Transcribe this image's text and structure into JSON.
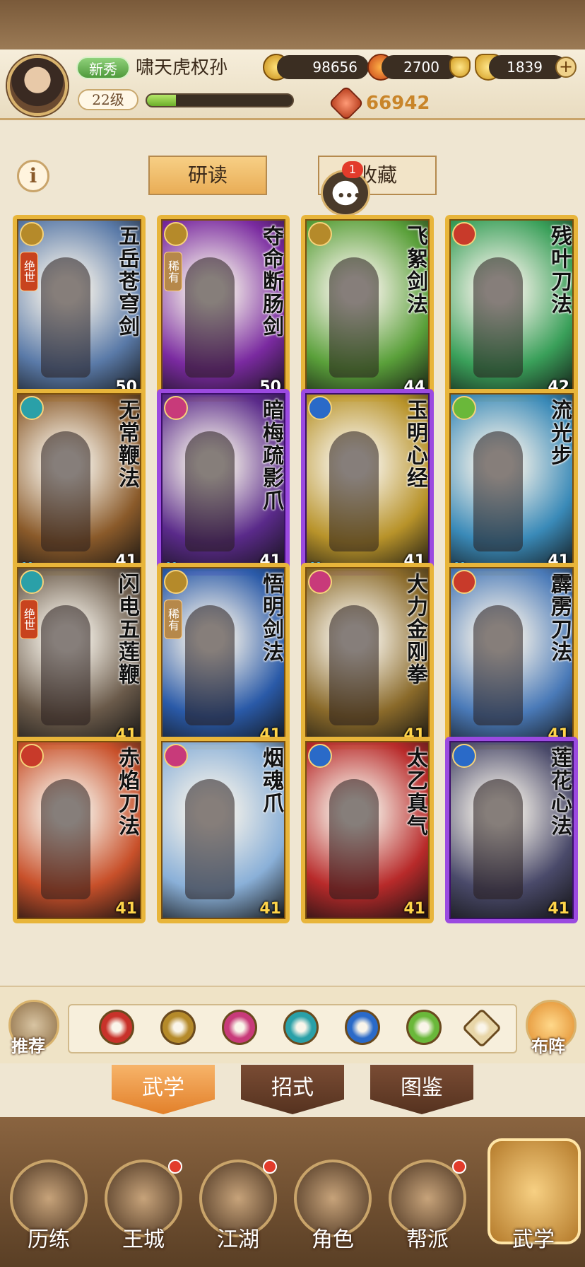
{
  "header": {
    "rank_badge": "新秀",
    "player_name": "啸天虎权孙",
    "level": "22级",
    "xp_fraction": 0.2,
    "coins": "98656",
    "flames": "2700",
    "ingots": "1839",
    "power": "66942"
  },
  "tabs": {
    "study": "研读",
    "collection": "收藏",
    "chat_badge": "1"
  },
  "cards": [
    {
      "title": "五岳苍穹剑",
      "level": "50",
      "tag": "绝世",
      "frame": "gold",
      "icon_color": "#b58a2a",
      "art": "#5a7aa8"
    },
    {
      "title": "夺命断肠剑",
      "level": "50",
      "tag": "稀有",
      "frame": "gold",
      "icon_color": "#b58a2a",
      "art": "#7a2aa0"
    },
    {
      "title": "飞絮剑法",
      "level": "44",
      "tag": "",
      "frame": "gold",
      "icon_color": "#b58a2a",
      "art": "#5aa03a"
    },
    {
      "title": "残叶刀法",
      "level": "42",
      "tag": "",
      "frame": "gold",
      "icon_color": "#c83a2a",
      "art": "#3aa05a"
    },
    {
      "title": "无常鞭法",
      "level": "41",
      "tag": "",
      "frame": "gold",
      "icon_color": "#2aa0a8",
      "art": "#8a5a2a",
      "drops": true
    },
    {
      "title": "暗梅疏影爪",
      "level": "41",
      "tag": "",
      "frame": "purple",
      "icon_color": "#c83a7a",
      "art": "#5a2a8a",
      "drops": true
    },
    {
      "title": "玉明心经",
      "level": "41",
      "tag": "",
      "frame": "purple",
      "icon_color": "#2a6ac8",
      "art": "#b8932a",
      "drops": true
    },
    {
      "title": "流光步",
      "level": "41",
      "tag": "",
      "frame": "gold",
      "icon_color": "#6ab83a",
      "art": "#3a8ab8",
      "drops": true
    },
    {
      "title": "闪电五莲鞭",
      "level": "41",
      "tag": "绝世",
      "frame": "gold",
      "icon_color": "#2aa0a8",
      "art": "#6a5a4a",
      "gold_level": true
    },
    {
      "title": "悟明剑法",
      "level": "41",
      "tag": "稀有",
      "frame": "gold",
      "icon_color": "#b58a2a",
      "art": "#2a5aa8",
      "gold_level": true
    },
    {
      "title": "大力金刚拳",
      "level": "41",
      "tag": "",
      "frame": "gold",
      "icon_color": "#c83a7a",
      "art": "#8a6a2a",
      "gold_level": true
    },
    {
      "title": "霹雳刀法",
      "level": "41",
      "tag": "",
      "frame": "gold",
      "icon_color": "#c83a2a",
      "art": "#4a7ab8",
      "gold_level": true
    },
    {
      "title": "赤焰刀法",
      "level": "41",
      "tag": "",
      "frame": "gold",
      "icon_color": "#c83a2a",
      "art": "#c8502a",
      "gold_level": true
    },
    {
      "title": "烟魂爪",
      "level": "41",
      "tag": "",
      "frame": "gold",
      "icon_color": "#c83a7a",
      "art": "#8ab0d8",
      "gold_level": true
    },
    {
      "title": "太乙真气",
      "level": "41",
      "tag": "",
      "frame": "gold",
      "icon_color": "#2a6ac8",
      "art": "#b82a2a",
      "gold_level": true
    },
    {
      "title": "莲花心法",
      "level": "41",
      "tag": "",
      "frame": "purple",
      "icon_color": "#2a6ac8",
      "art": "#4a4a6a",
      "gold_level": true
    }
  ],
  "filter": {
    "recommend": "推荐",
    "formation": "布阵",
    "icons": [
      {
        "name": "blade-icon",
        "color": "#c8322a"
      },
      {
        "name": "sword-icon",
        "color": "#b58a2a"
      },
      {
        "name": "fist-icon",
        "color": "#c83a7a"
      },
      {
        "name": "fan-icon",
        "color": "#2aa0a8"
      },
      {
        "name": "yinyang-icon",
        "color": "#2a6ac8"
      },
      {
        "name": "swirl-icon",
        "color": "#6ab83a"
      },
      {
        "name": "pyramid-icon",
        "color": "#e8d6a8"
      }
    ]
  },
  "sections": {
    "martial": "武学",
    "moves": "招式",
    "atlas": "图鉴"
  },
  "nav": [
    {
      "label": "历练",
      "dot": false
    },
    {
      "label": "王城",
      "dot": true
    },
    {
      "label": "江湖",
      "dot": true
    },
    {
      "label": "角色",
      "dot": false
    },
    {
      "label": "帮派",
      "dot": true
    },
    {
      "label": "武学",
      "dot": false,
      "active": true
    }
  ]
}
